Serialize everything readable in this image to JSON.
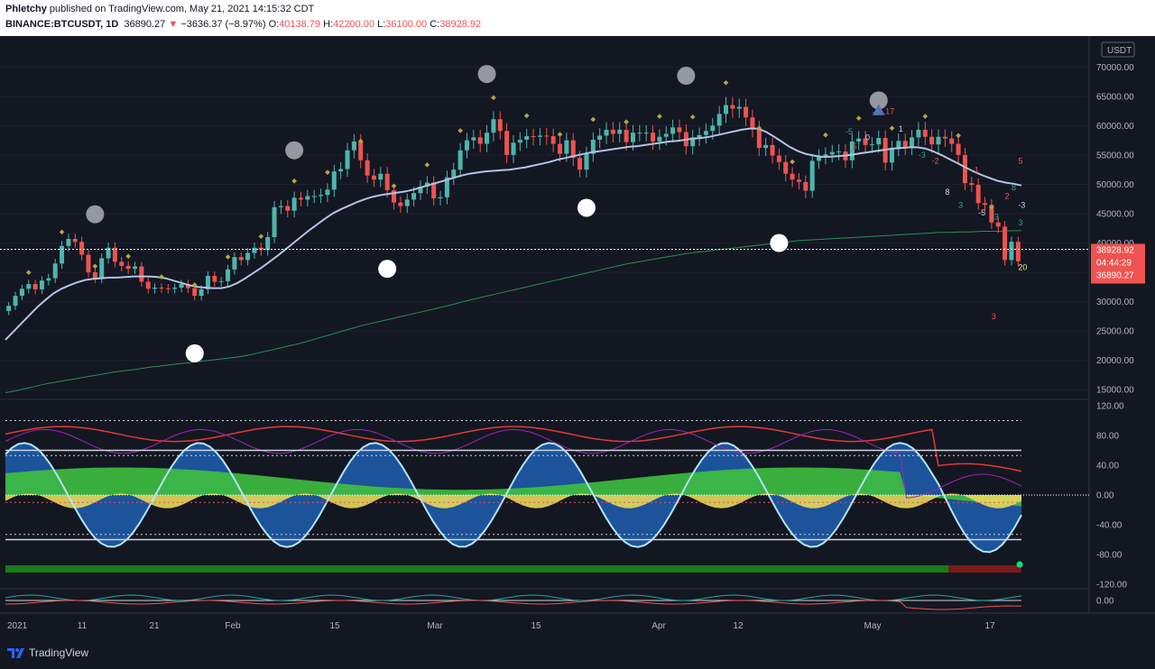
{
  "header": {
    "author": "Phletchy",
    "published_text": "published on TradingView.com, May 21, 2021 14:15:32 CDT",
    "symbol": "BINANCE:BTCUSDT, 1D",
    "last": "36890.27",
    "change": "−3636.37 (−8.97%)",
    "o_label": "O:",
    "o_value": "40138.79",
    "h_label": "H:",
    "h_value": "42200.00",
    "l_label": "L:",
    "l_value": "36100.00",
    "c_label": "C:",
    "c_value": "38928.92"
  },
  "footer": {
    "brand": "TradingView"
  },
  "colors": {
    "bg": "#131722",
    "up": "#4db6ac",
    "down": "#ef5350",
    "ma_fast": "#b3c3e0",
    "ma_slow": "#2e8b57",
    "osc_blue": "#1e5aa8",
    "osc_green": "#3fbf3f",
    "osc_yellow": "#e6d85c",
    "osc_red": "#e53935",
    "osc_purple": "#9c27b0"
  },
  "chart_data": [
    {
      "type": "candlestick",
      "currency": "USDT",
      "x_ticks": [
        "2021",
        "11",
        "21",
        "Feb",
        "15",
        "Mar",
        "15",
        "Apr",
        "12",
        "May",
        "17"
      ],
      "y_ticks": [
        "70000.00",
        "65000.00",
        "60000.00",
        "55000.00",
        "50000.00",
        "45000.00",
        "40000.00",
        "35000.00",
        "30000.00",
        "25000.00",
        "20000.00",
        "15000.00"
      ],
      "ylim": [
        13500,
        72500
      ],
      "price_labels": {
        "close": "38928.92",
        "countdown": "04:44:29",
        "last": "36890.27"
      },
      "close": [
        29300,
        31000,
        32200,
        33000,
        32100,
        33600,
        34000,
        36500,
        39500,
        40700,
        40200,
        38000,
        35000,
        34000,
        37400,
        39200,
        36800,
        36100,
        35600,
        36000,
        33400,
        32200,
        32400,
        32300,
        32200,
        32400,
        33000,
        32300,
        31000,
        32100,
        34400,
        33400,
        33500,
        35500,
        37600,
        37100,
        38300,
        39200,
        38800,
        41000,
        46100,
        46300,
        45500,
        47700,
        47400,
        48000,
        48000,
        48200,
        49100,
        52200,
        52600,
        55800,
        57300,
        54100,
        51500,
        50800,
        51800,
        49000,
        46900,
        46300,
        47400,
        48500,
        49600,
        50300,
        47600,
        47800,
        51200,
        52500,
        55800,
        57500,
        58000,
        56900,
        58800,
        61100,
        59100,
        55000,
        57100,
        57600,
        58200,
        58100,
        58300,
        58200,
        56900,
        55200,
        57500,
        54500,
        52500,
        55200,
        57600,
        58300,
        59300,
        58600,
        59300,
        57200,
        58800,
        58800,
        58800,
        57300,
        58100,
        58600,
        59700,
        58900,
        56500,
        58000,
        58400,
        59100,
        60000,
        62000,
        63500,
        62900,
        63200,
        61400,
        59500,
        56200,
        56700,
        54900,
        53800,
        51800,
        50800,
        50400,
        48900,
        54000,
        54800,
        55100,
        55500,
        55600,
        54100,
        57300,
        57800,
        56700,
        56800,
        57900,
        53700,
        56200,
        57400,
        56400,
        58000,
        59300,
        58100,
        56800,
        58100,
        57800,
        56900,
        55000,
        50200,
        49900,
        46800,
        46500,
        43500,
        42800,
        37100,
        40200,
        36890
      ],
      "ma_fast": [
        23500,
        24900,
        26300,
        27700,
        29100,
        30300,
        31400,
        32200,
        32800,
        33300,
        33700,
        33900,
        34000,
        34100,
        34100,
        34200,
        34300,
        34300,
        34300,
        34200,
        34000,
        33600,
        33200,
        32800,
        32500,
        32400,
        32300,
        32300,
        32600,
        33200,
        34000,
        34900,
        35800,
        36800,
        37800,
        38900,
        40000,
        41100,
        42200,
        43200,
        44200,
        45100,
        45800,
        46400,
        47000,
        47500,
        47900,
        48200,
        48400,
        48600,
        48800,
        49100,
        49500,
        49900,
        50300,
        50700,
        51100,
        51500,
        51800,
        52000,
        52200,
        52300,
        52400,
        52500,
        52700,
        52900,
        53200,
        53500,
        53800,
        54200,
        54500,
        54800,
        55100,
        55400,
        55600,
        55800,
        56000,
        56200,
        56400,
        56500,
        56700,
        56900,
        57100,
        57300,
        57400,
        57600,
        57800,
        57900,
        58100,
        58400,
        58700,
        59000,
        59300,
        59500,
        59500,
        59000,
        58200,
        57300,
        56400,
        55700,
        55200,
        54900,
        54700,
        54700,
        54800,
        54900,
        55100,
        55300,
        55500,
        55700,
        55900,
        56100,
        56200,
        56300,
        56300,
        56100,
        55600,
        55000,
        54300,
        53600,
        52900,
        52200,
        51600,
        51100,
        50600,
        50300,
        50100,
        49800
      ],
      "ma_slow": [
        14500,
        14800,
        15200,
        15600,
        16000,
        16300,
        16600,
        16900,
        17200,
        17500,
        17800,
        18100,
        18300,
        18500,
        18800,
        19000,
        19200,
        19400,
        19600,
        19800,
        20000,
        20200,
        20400,
        20600,
        20900,
        21300,
        21700,
        22100,
        22500,
        22900,
        23400,
        23900,
        24400,
        24900,
        25400,
        25900,
        26300,
        26700,
        27100,
        27500,
        27900,
        28300,
        28700,
        29100,
        29500,
        30000,
        30400,
        30800,
        31200,
        31600,
        32000,
        32400,
        32800,
        33200,
        33600,
        34000,
        34400,
        34800,
        35200,
        35600,
        36000,
        36400,
        36700,
        37000,
        37300,
        37600,
        37900,
        38200,
        38400,
        38600,
        38800,
        39000,
        39200,
        39400,
        39600,
        39800,
        40000,
        40200,
        40400,
        40500,
        40600,
        40700,
        40800,
        40900,
        41000,
        41100,
        41200,
        41300,
        41400,
        41500,
        41600,
        41700,
        41800,
        41800,
        41900,
        41900,
        42000,
        42000,
        42000,
        42100,
        42100
      ],
      "annotations": {
        "grey_dots": [
          [
            13,
            44900
          ],
          [
            43,
            55800
          ],
          [
            72,
            68800
          ],
          [
            102,
            68500
          ],
          [
            131,
            64300
          ]
        ],
        "white_dots": [
          [
            28,
            21200
          ],
          [
            57,
            35600
          ],
          [
            87,
            46000
          ],
          [
            116,
            40000
          ]
        ],
        "numbers": [
          "-5",
          "5",
          "0",
          "-3",
          "17",
          "1",
          "-3",
          "-2",
          "8",
          "3",
          "-1",
          "-5",
          "-3",
          "2",
          "-3",
          "3",
          "5",
          "20",
          "8",
          "3"
        ]
      }
    },
    {
      "type": "area",
      "y_ticks": [
        "120.00",
        "80.00",
        "40.00",
        "0.00",
        "-40.00",
        "-80.00",
        "-120.00"
      ],
      "ylim": [
        -120,
        120
      ],
      "levels": [
        60,
        53,
        -53,
        -60,
        100,
        -10
      ]
    },
    {
      "type": "line",
      "y_ticks": [
        "0.00"
      ]
    }
  ]
}
